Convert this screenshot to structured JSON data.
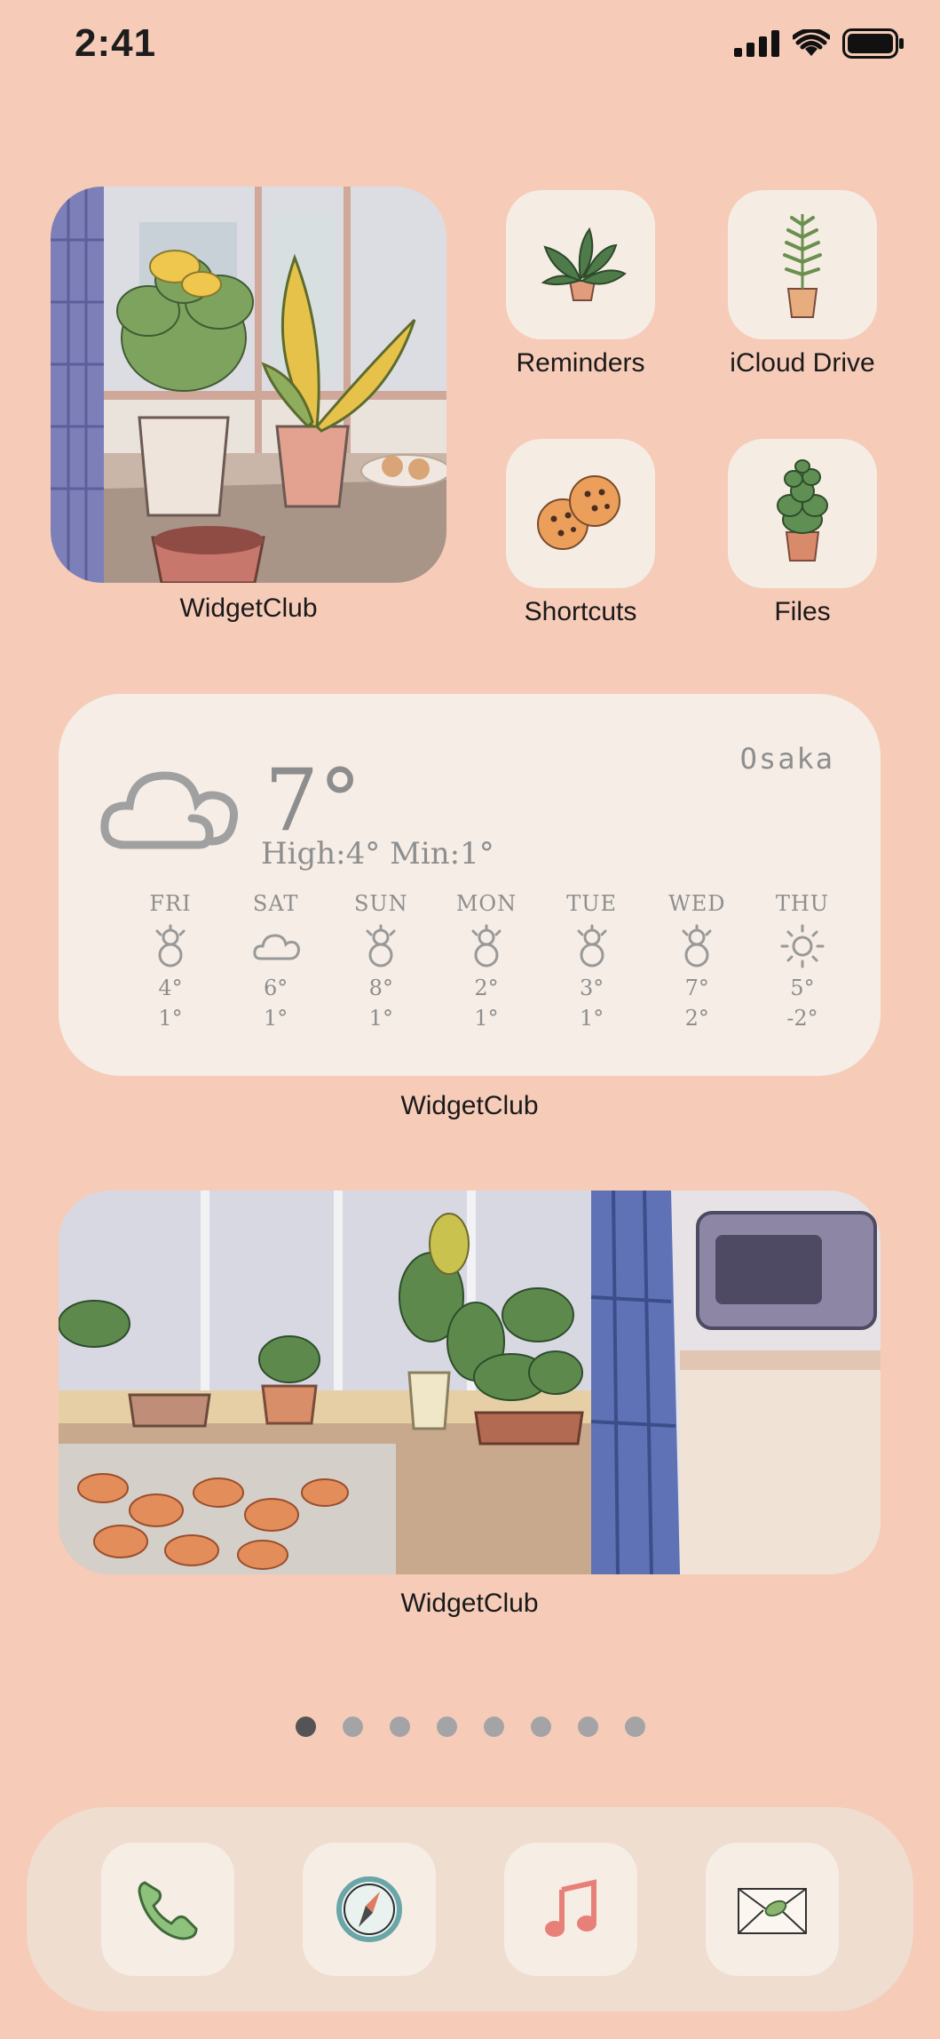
{
  "status_bar": {
    "time": "2:41"
  },
  "widgets": {
    "photo_small": {
      "label": "WidgetClub"
    },
    "weather": {
      "label": "WidgetClub",
      "city": "Osaka",
      "current_temp": "7°",
      "high_low": "High:4° Min:1°",
      "current_icon": "cloud-icon",
      "forecast": [
        {
          "day": "FRI",
          "icon": "snowman-icon",
          "high": "4°",
          "low": "1°"
        },
        {
          "day": "SAT",
          "icon": "cloud-icon",
          "high": "6°",
          "low": "1°"
        },
        {
          "day": "SUN",
          "icon": "snowman-icon",
          "high": "8°",
          "low": "1°"
        },
        {
          "day": "MON",
          "icon": "snowman-icon",
          "high": "2°",
          "low": "1°"
        },
        {
          "day": "TUE",
          "icon": "snowman-icon",
          "high": "3°",
          "low": "1°"
        },
        {
          "day": "WED",
          "icon": "snowman-icon",
          "high": "7°",
          "low": "2°"
        },
        {
          "day": "THU",
          "icon": "sun-icon",
          "high": "5°",
          "low": "-2°"
        }
      ]
    },
    "photo_wide": {
      "label": "WidgetClub"
    }
  },
  "apps": [
    {
      "name": "Reminders",
      "icon": "plant-icon"
    },
    {
      "name": "iCloud Drive",
      "icon": "fern-icon"
    },
    {
      "name": "Shortcuts",
      "icon": "cookies-icon"
    },
    {
      "name": "Files",
      "icon": "succulent-icon"
    }
  ],
  "page_dots": {
    "count": 8,
    "active_index": 0
  },
  "dock": [
    {
      "icon": "phone-icon"
    },
    {
      "icon": "compass-icon"
    },
    {
      "icon": "music-note-icon"
    },
    {
      "icon": "mail-icon"
    }
  ],
  "colors": {
    "background": "#f6cbb8",
    "tile": "#f5ece4",
    "dock": "#efddd0"
  }
}
